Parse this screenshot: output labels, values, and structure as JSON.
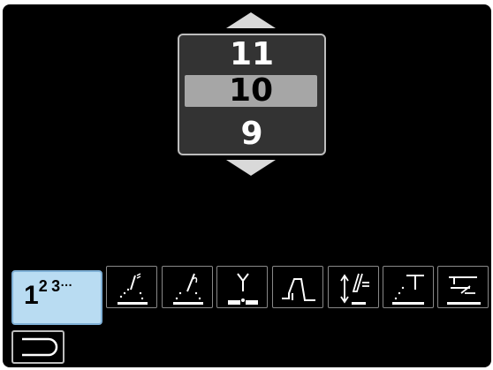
{
  "picker": {
    "values": [
      "11",
      "10",
      "9"
    ],
    "selected_value": "10"
  },
  "toolbar": {
    "selected_tile_label": {
      "main": "1",
      "sup1": "2",
      "sup2": "3",
      "dots": "…"
    },
    "icons": [
      "smaw-electrode-icon",
      "gmaw-torch-icon",
      "joint-preparation-icon",
      "pulse-waveform-icon",
      "electrode-feed-icon",
      "weld-spatter-icon",
      "torch-settings-icon"
    ]
  },
  "colors": {
    "screen": "#000000",
    "picker_bg": "#333333",
    "picker_selected": "#a6a6a6",
    "selected_tile": "#b9dcf2"
  }
}
